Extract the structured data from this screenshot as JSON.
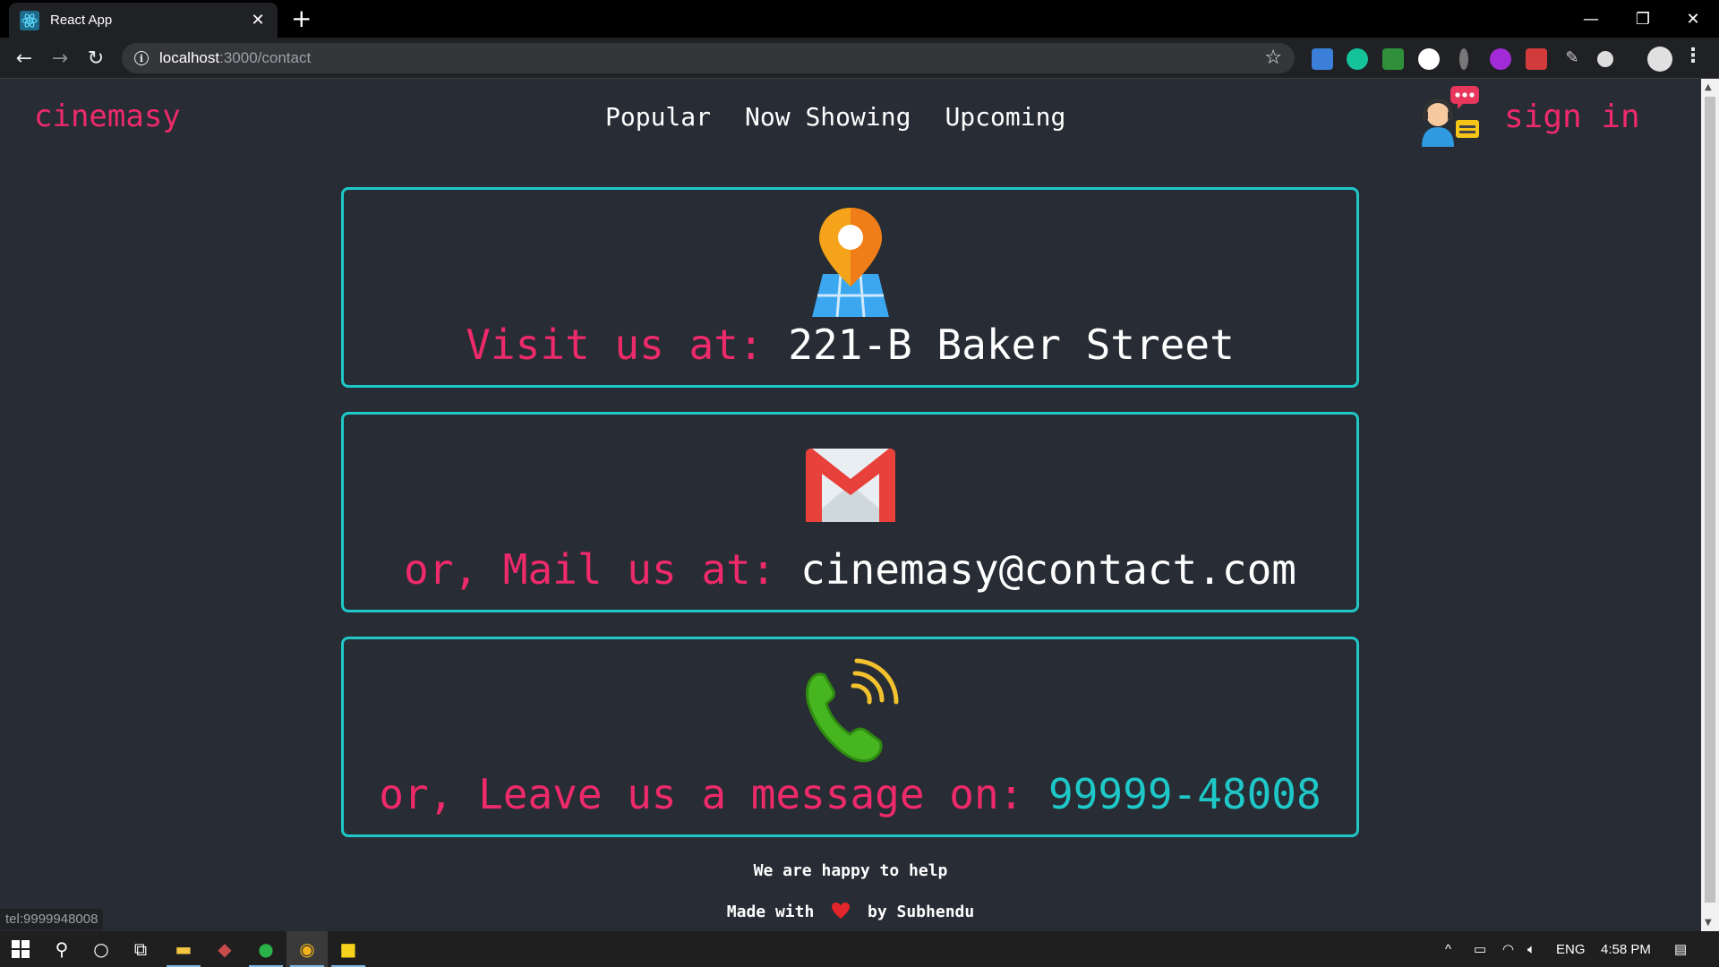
{
  "browser": {
    "tab_title": "React App",
    "url_host": "localhost",
    "url_path": ":3000/contact",
    "status_tooltip": "tel:9999948008"
  },
  "header": {
    "brand": "cinemasy",
    "nav": [
      "Popular",
      "Now Showing",
      "Upcoming"
    ],
    "signin": "sign in"
  },
  "cards": [
    {
      "label": "Visit us at: ",
      "value": "221-B Baker Street",
      "icon": "map-pin-icon"
    },
    {
      "label": "or, Mail us at: ",
      "value": "cinemasy@contact.com",
      "icon": "gmail-icon"
    },
    {
      "label": "or, Leave us a message on: ",
      "value": "99999-48008",
      "icon": "phone-icon"
    }
  ],
  "footer": {
    "line1": "We are happy to help",
    "made_with": "Made with",
    "by": "by Subhendu"
  },
  "taskbar": {
    "language": "ENG",
    "time": "4:58 PM"
  },
  "colors": {
    "accent_pink": "#ee2a6b",
    "accent_teal": "#1fc8c8",
    "background": "#282c34"
  }
}
